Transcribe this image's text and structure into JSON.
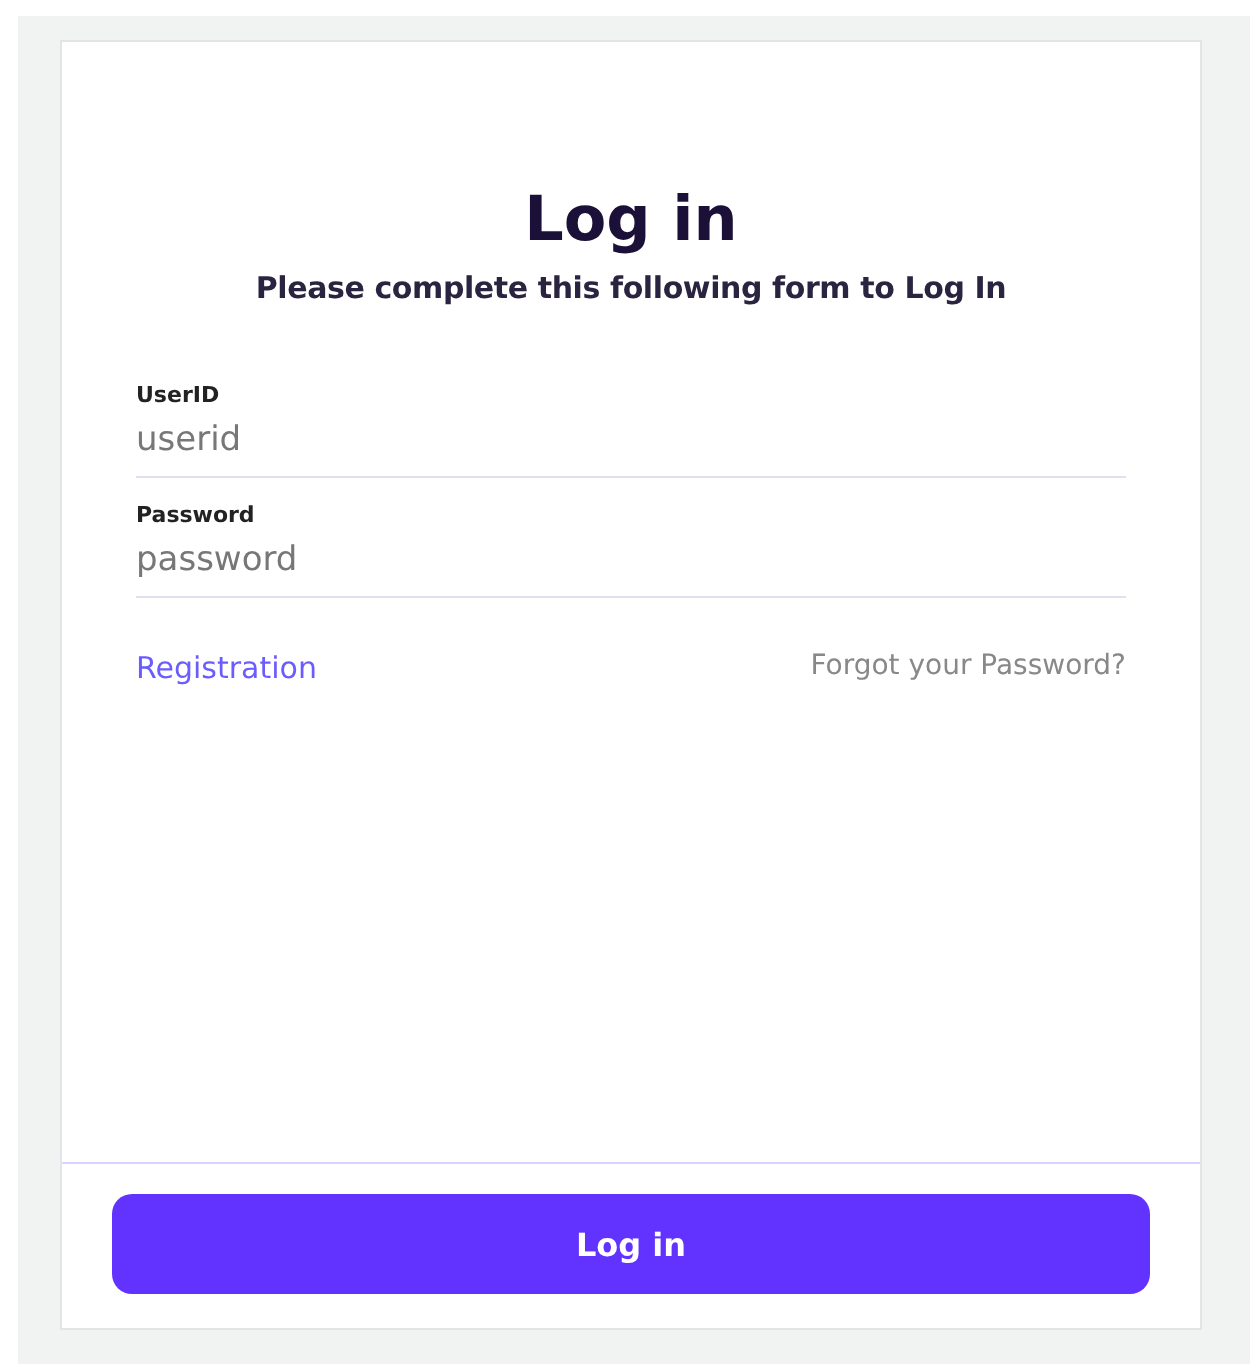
{
  "title": "Log in",
  "subtitle": "Please complete this following form to Log In",
  "fields": [
    {
      "label": "UserID",
      "placeholder": "userid"
    },
    {
      "label": "Password",
      "placeholder": "password"
    }
  ],
  "links": {
    "registration": "Registration",
    "forgot": "Forgot your Password?"
  },
  "submit": "Log in"
}
